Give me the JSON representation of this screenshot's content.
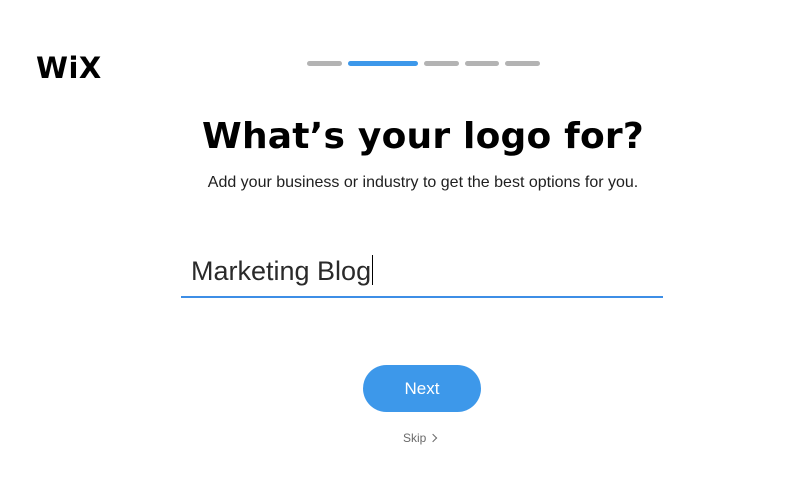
{
  "brand": {
    "logo_text": "WiX"
  },
  "progress": {
    "total_steps": 5,
    "current_step": 2,
    "active_color": "#3d98ea",
    "inactive_color": "#b3b3b3"
  },
  "main": {
    "title": "What’s your logo for?",
    "subtitle": "Add your business or industry to get the best options for you."
  },
  "business_field": {
    "value": "Marketing Blog",
    "underline_color": "#3d8ee6"
  },
  "actions": {
    "next_label": "Next",
    "next_color": "#3d98ea",
    "skip_label": "Skip",
    "skip_icon": "chevron-right-icon"
  }
}
